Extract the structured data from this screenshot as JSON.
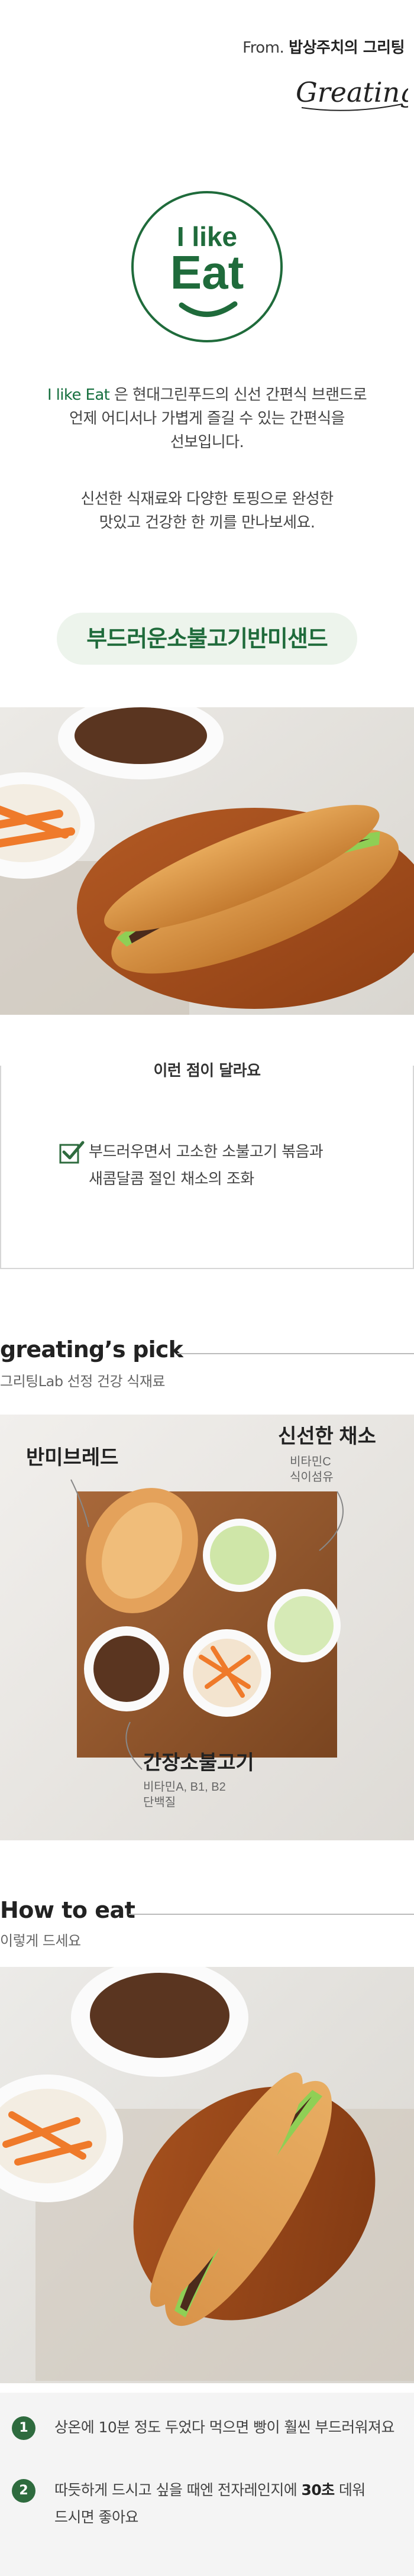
{
  "header": {
    "from_prefix": "From.",
    "from_brand": "밥상주치의 그리팅",
    "script_brand": "Greating"
  },
  "logo": {
    "line1": "I like",
    "line2": "Eat"
  },
  "intro": {
    "brand_name": "I like Eat",
    "line1_rest": " 은 현대그린푸드의 신선 간편식 브랜드로",
    "line2": "언제 어디서나 가볍게 즐길 수 있는 간편식을",
    "line3": "선보입니다.",
    "line4": "신선한 식재료와 다양한 토핑으로 완성한",
    "line5": "맛있고 건강한 한 끼를 만나보세요."
  },
  "product": {
    "title": "부드러운소불고기반미샌드"
  },
  "feature": {
    "title": "이런 점이 달라요",
    "line1": "부드러우면서 고소한 소불고기 볶음과",
    "line2": "새콤달콤 절인 채소의 조화"
  },
  "pick": {
    "title": "greating’s pick",
    "subtitle": "그리팅Lab 선정 건강 식재료",
    "label_bread": "반미브레드",
    "label_veg": "신선한 채소",
    "label_veg_sub1": "비타민C",
    "label_veg_sub2": "식이섬유",
    "label_beef": "간장소불고기",
    "label_beef_sub1": "비타민A, B1, B2",
    "label_beef_sub2": "단백질"
  },
  "how": {
    "title": "How to eat",
    "subtitle": "이렇게 드세요",
    "step1_num": "1",
    "step1_text": "상온에 10분 정도 두었다 먹으면 빵이 훨씬 부드러워져요",
    "step2_num": "2",
    "step2_pre": "따듯하게 드시고 싶을 때엔 전자레인지에 ",
    "step2_bold": "30초",
    "step2_post": " 데워",
    "step2_line2": "드시면 좋아요"
  },
  "colors": {
    "brand_green": "#1f6b3b",
    "pill_bg": "#edf4ec",
    "step_badge": "#2e6b3e"
  }
}
